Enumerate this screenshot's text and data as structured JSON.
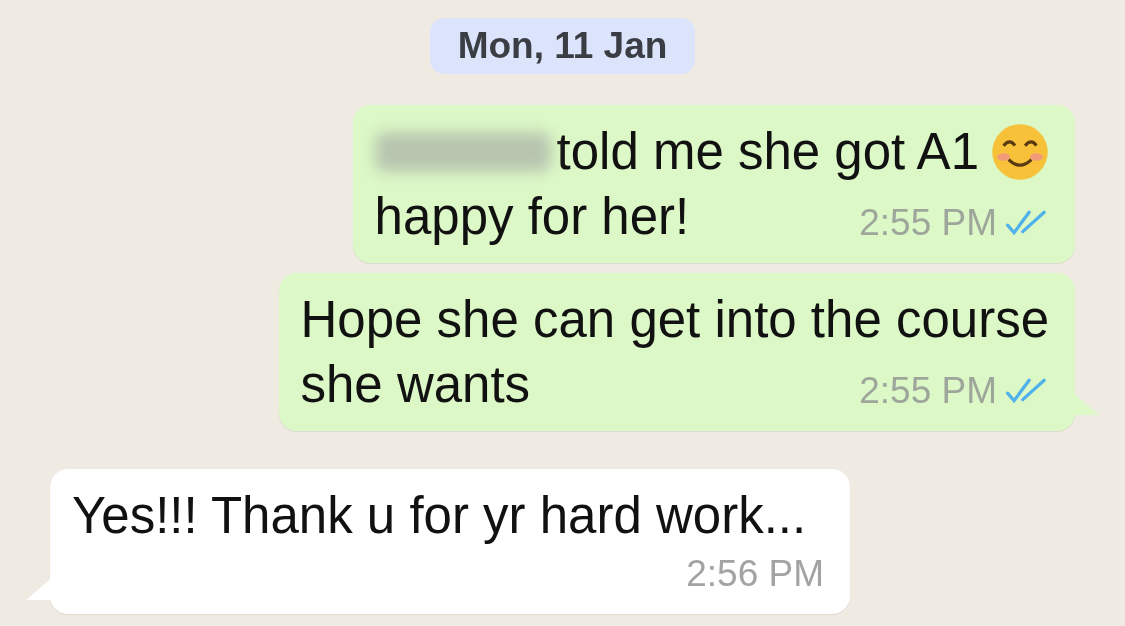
{
  "date_chip": "Mon, 11 Jan",
  "messages": [
    {
      "kind": "outgoing",
      "redacted_prefix": true,
      "lines": [
        "told me she got A1",
        "happy for her!"
      ],
      "emoji": true,
      "time": "2:55 PM",
      "read": true,
      "tail": false
    },
    {
      "kind": "outgoing",
      "lines": [
        "Hope she can get into the course",
        "she wants"
      ],
      "time": "2:55 PM",
      "read": true,
      "tail": true
    },
    {
      "kind": "incoming",
      "lines": [
        "Yes!!! Thank u for yr hard work..."
      ],
      "time": "2:56 PM",
      "tail": true
    }
  ]
}
